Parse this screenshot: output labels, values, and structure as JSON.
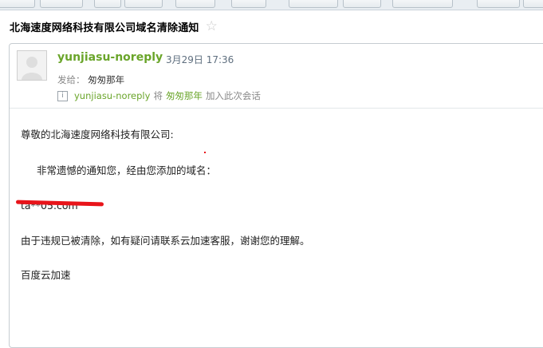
{
  "email": {
    "subject": "北海速度网络科技有限公司域名清除通知",
    "sender": "yunjiasu-noreply",
    "date": "3月29日 17:36",
    "recipient_label": "发给：",
    "recipient": "匆匆那年",
    "conversation": {
      "from": "yunjiasu-noreply",
      "to_prefix": "将",
      "to": "匆匆那年",
      "action": "加入此次会话"
    }
  },
  "body": {
    "greeting": "尊敬的北海速度网络科技有限公司:",
    "line1": "非常遗憾的通知您，经由您添加的域名：",
    "domain_redacted": "ta**05.com",
    "line2": "由于违规已被清除，如有疑问请联系云加速客服，谢谢您的理解。",
    "signature": "百度云加速"
  },
  "icons": {
    "star": "star-outline-icon",
    "info": "info-icon",
    "avatar": "default-avatar"
  },
  "colors": {
    "sender_green": "#6aa52a",
    "redact_red": "#e8141a"
  }
}
